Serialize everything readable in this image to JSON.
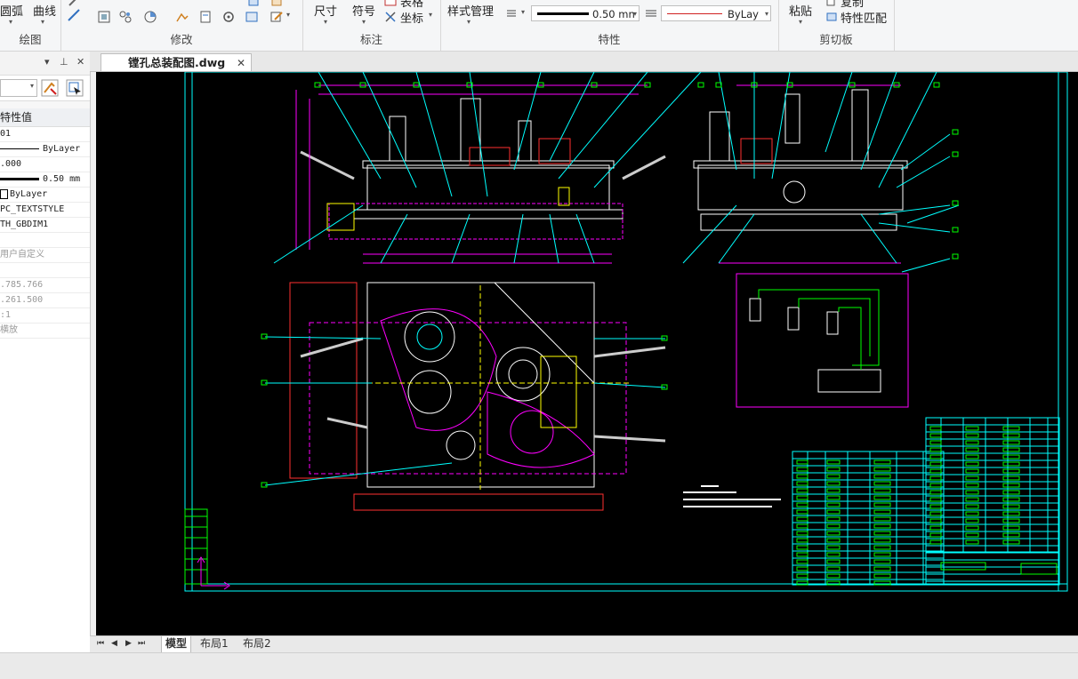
{
  "ribbon": {
    "draw_group": {
      "title": "绘图",
      "arc": "圆弧",
      "curve": "曲线"
    },
    "modify_group": {
      "title": "修改"
    },
    "annotation_group": {
      "title": "标注",
      "dimension": "尺寸",
      "symbol": "符号",
      "table": "表格",
      "coordinate": "坐标"
    },
    "properties_group": {
      "title": "特性",
      "style_manager": "样式管理",
      "lineweight": "0.50 mn",
      "linetype": "ByLay"
    },
    "clipboard_group": {
      "title": "剪切板",
      "paste": "粘贴",
      "copy": "复制",
      "match_props": "特性匹配"
    }
  },
  "properties_panel": {
    "header": "特性值",
    "rows": [
      {
        "value": "01",
        "style": "normal"
      },
      {
        "value": "ByLayer",
        "style": "line"
      },
      {
        "value": ".000",
        "style": "normal"
      },
      {
        "value": "0.50 mm",
        "style": "thick"
      },
      {
        "value": "ByLayer",
        "style": "box"
      },
      {
        "value": "PC_TEXTSTYLE",
        "style": "normal"
      },
      {
        "value": "TH_GBDIM1",
        "style": "normal"
      },
      {
        "value": "",
        "style": "normal"
      },
      {
        "value": "用户自定义",
        "style": "gray"
      },
      {
        "value": "",
        "style": "gray"
      },
      {
        "value": ".785.766",
        "style": "gray"
      },
      {
        "value": ".261.500",
        "style": "gray"
      },
      {
        "value": ":1",
        "style": "gray"
      },
      {
        "value": "横放",
        "style": "gray"
      }
    ]
  },
  "document_tab": {
    "name": "镗孔总装配图.dwg"
  },
  "layout_tabs": {
    "model": "模型",
    "layout1": "布局1",
    "layout2": "布局2"
  },
  "colors": {
    "canvas_bg": "#000000",
    "cad_cyan": "#00ffff",
    "cad_magenta": "#ff00ff",
    "cad_green": "#00ff00",
    "cad_white": "#ffffff",
    "cad_yellow": "#ffff00",
    "cad_red": "#ff3030"
  }
}
